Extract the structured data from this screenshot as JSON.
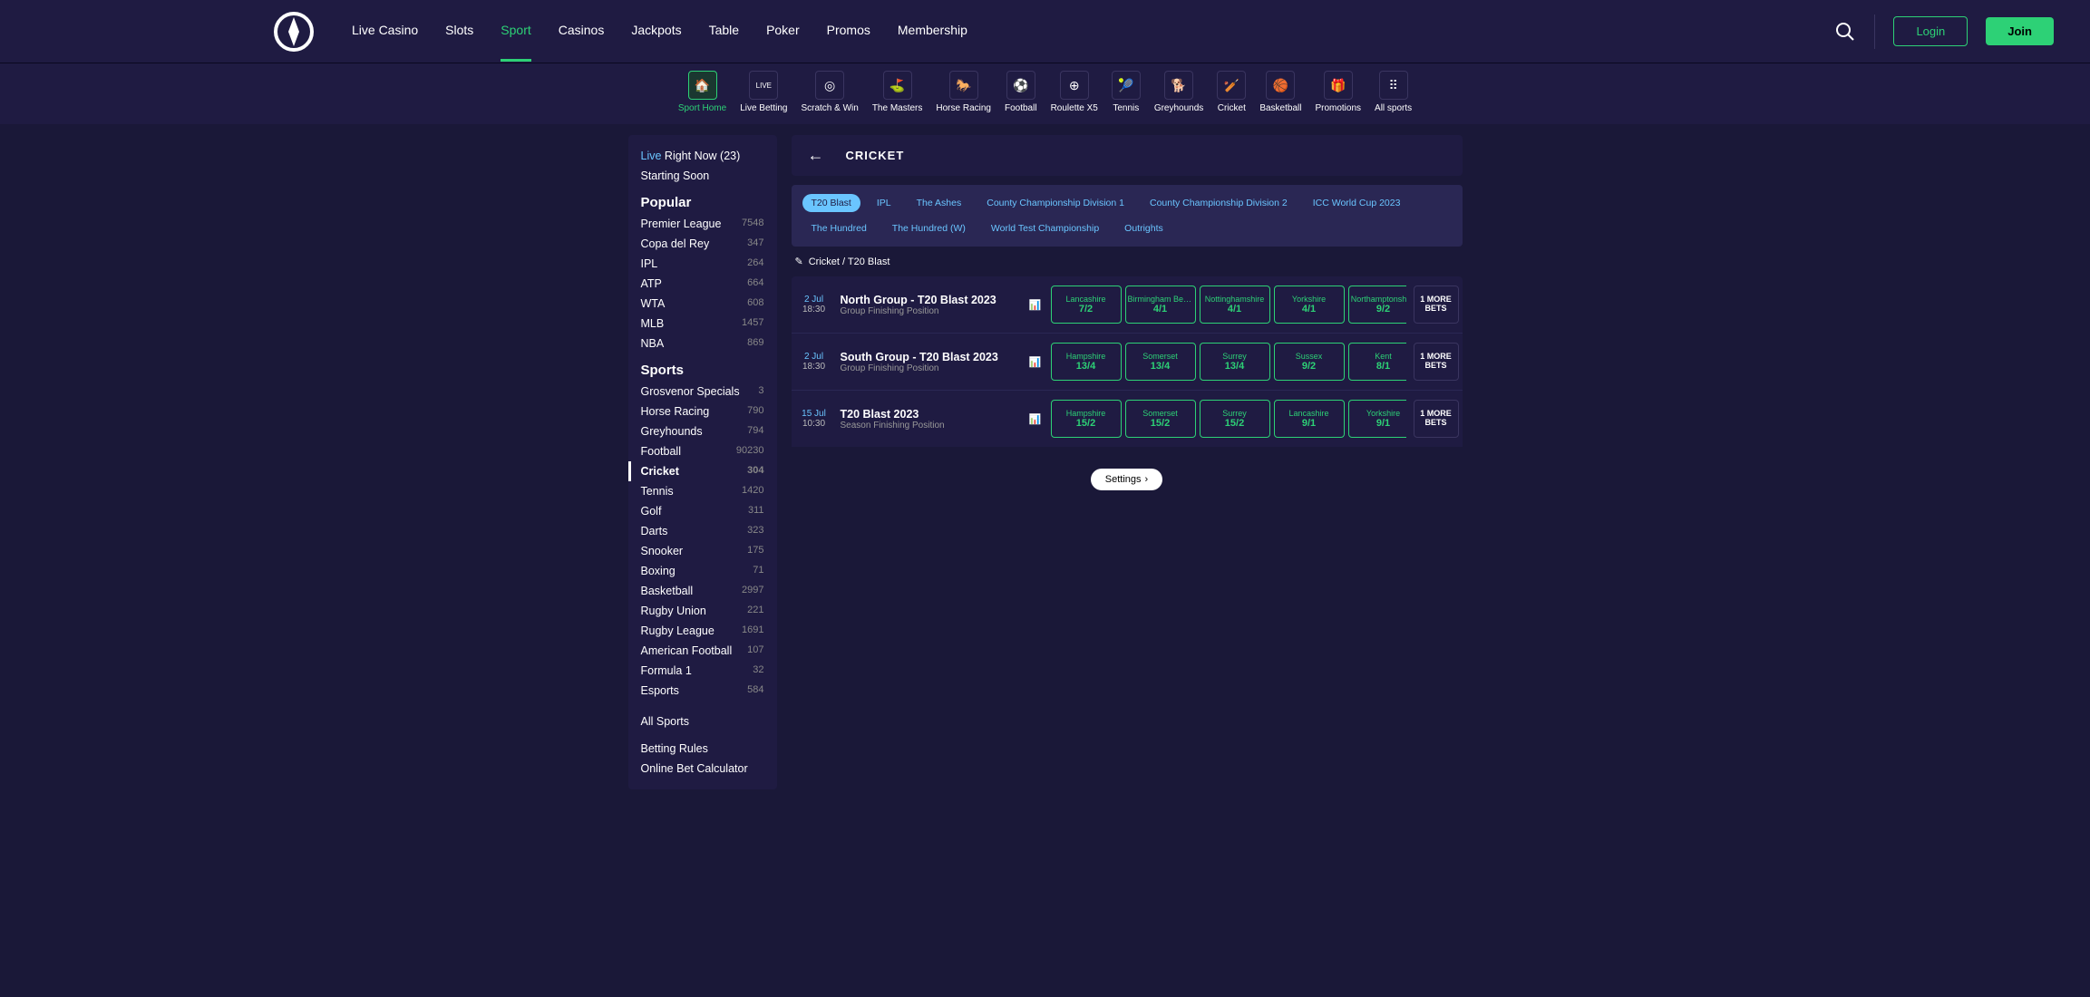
{
  "header": {
    "nav": [
      "Live Casino",
      "Slots",
      "Sport",
      "Casinos",
      "Jackpots",
      "Table",
      "Poker",
      "Promos",
      "Membership"
    ],
    "active_nav": 2,
    "login": "Login",
    "join": "Join"
  },
  "subnav": [
    {
      "label": "Sport Home",
      "icon": "🏠"
    },
    {
      "label": "Live Betting",
      "icon": "LIVE"
    },
    {
      "label": "Scratch & Win",
      "icon": "◎"
    },
    {
      "label": "The Masters",
      "icon": "⛳"
    },
    {
      "label": "Horse Racing",
      "icon": "🐎"
    },
    {
      "label": "Football",
      "icon": "⚽"
    },
    {
      "label": "Roulette X5",
      "icon": "⊕"
    },
    {
      "label": "Tennis",
      "icon": "🎾"
    },
    {
      "label": "Greyhounds",
      "icon": "🐕"
    },
    {
      "label": "Cricket",
      "icon": "🏏"
    },
    {
      "label": "Basketball",
      "icon": "🏀"
    },
    {
      "label": "Promotions",
      "icon": "🎁"
    },
    {
      "label": "All sports",
      "icon": "⠿"
    }
  ],
  "subnav_active": 0,
  "sidebar": {
    "live_prefix": "Live",
    "live_suffix": " Right Now  (23)",
    "starting_soon": "Starting Soon",
    "popular_heading": "Popular",
    "popular": [
      {
        "label": "Premier League",
        "count": "7548"
      },
      {
        "label": "Copa del Rey",
        "count": "347"
      },
      {
        "label": "IPL",
        "count": "264"
      },
      {
        "label": "ATP",
        "count": "664"
      },
      {
        "label": "WTA",
        "count": "608"
      },
      {
        "label": "MLB",
        "count": "1457"
      },
      {
        "label": "NBA",
        "count": "869"
      }
    ],
    "sports_heading": "Sports",
    "sports": [
      {
        "label": "Grosvenor Specials",
        "count": "3"
      },
      {
        "label": "Horse Racing",
        "count": "790"
      },
      {
        "label": "Greyhounds",
        "count": "794"
      },
      {
        "label": "Football",
        "count": "90230"
      },
      {
        "label": "Cricket",
        "count": "304"
      },
      {
        "label": "Tennis",
        "count": "1420"
      },
      {
        "label": "Golf",
        "count": "311"
      },
      {
        "label": "Darts",
        "count": "323"
      },
      {
        "label": "Snooker",
        "count": "175"
      },
      {
        "label": "Boxing",
        "count": "71"
      },
      {
        "label": "Basketball",
        "count": "2997"
      },
      {
        "label": "Rugby Union",
        "count": "221"
      },
      {
        "label": "Rugby League",
        "count": "1691"
      },
      {
        "label": "American Football",
        "count": "107"
      },
      {
        "label": "Formula 1",
        "count": "32"
      },
      {
        "label": "Esports",
        "count": "584"
      }
    ],
    "sports_selected": 4,
    "all_sports": "All Sports",
    "betting_rules": "Betting Rules",
    "calculator": "Online Bet Calculator"
  },
  "page": {
    "title": "CRICKET",
    "pills": [
      "T20 Blast",
      "IPL",
      "The Ashes",
      "County Championship Division 1",
      "County Championship Division 2",
      "ICC World Cup 2023",
      "The Hundred",
      "The Hundred (W)",
      "World Test Championship",
      "Outrights"
    ],
    "pill_active": 0,
    "breadcrumb": "Cricket / T20 Blast",
    "settings": "Settings",
    "more_bets": "1 MORE BETS"
  },
  "matches": [
    {
      "date": "2 Jul",
      "time": "18:30",
      "title": "North Group - T20 Blast 2023",
      "sub": "Group Finishing Position",
      "odds": [
        {
          "t": "Lancashire",
          "o": "7/2"
        },
        {
          "t": "Birmingham Bears",
          "o": "4/1"
        },
        {
          "t": "Nottinghamshire",
          "o": "4/1"
        },
        {
          "t": "Yorkshire",
          "o": "4/1"
        },
        {
          "t": "Northamptonshire",
          "o": "9/2"
        }
      ]
    },
    {
      "date": "2 Jul",
      "time": "18:30",
      "title": "South Group - T20 Blast 2023",
      "sub": "Group Finishing Position",
      "odds": [
        {
          "t": "Hampshire",
          "o": "13/4"
        },
        {
          "t": "Somerset",
          "o": "13/4"
        },
        {
          "t": "Surrey",
          "o": "13/4"
        },
        {
          "t": "Sussex",
          "o": "9/2"
        },
        {
          "t": "Kent",
          "o": "8/1"
        }
      ]
    },
    {
      "date": "15 Jul",
      "time": "10:30",
      "title": "T20 Blast 2023",
      "sub": "Season Finishing Position",
      "odds": [
        {
          "t": "Hampshire",
          "o": "15/2"
        },
        {
          "t": "Somerset",
          "o": "15/2"
        },
        {
          "t": "Surrey",
          "o": "15/2"
        },
        {
          "t": "Lancashire",
          "o": "9/1"
        },
        {
          "t": "Yorkshire",
          "o": "9/1"
        }
      ]
    }
  ]
}
